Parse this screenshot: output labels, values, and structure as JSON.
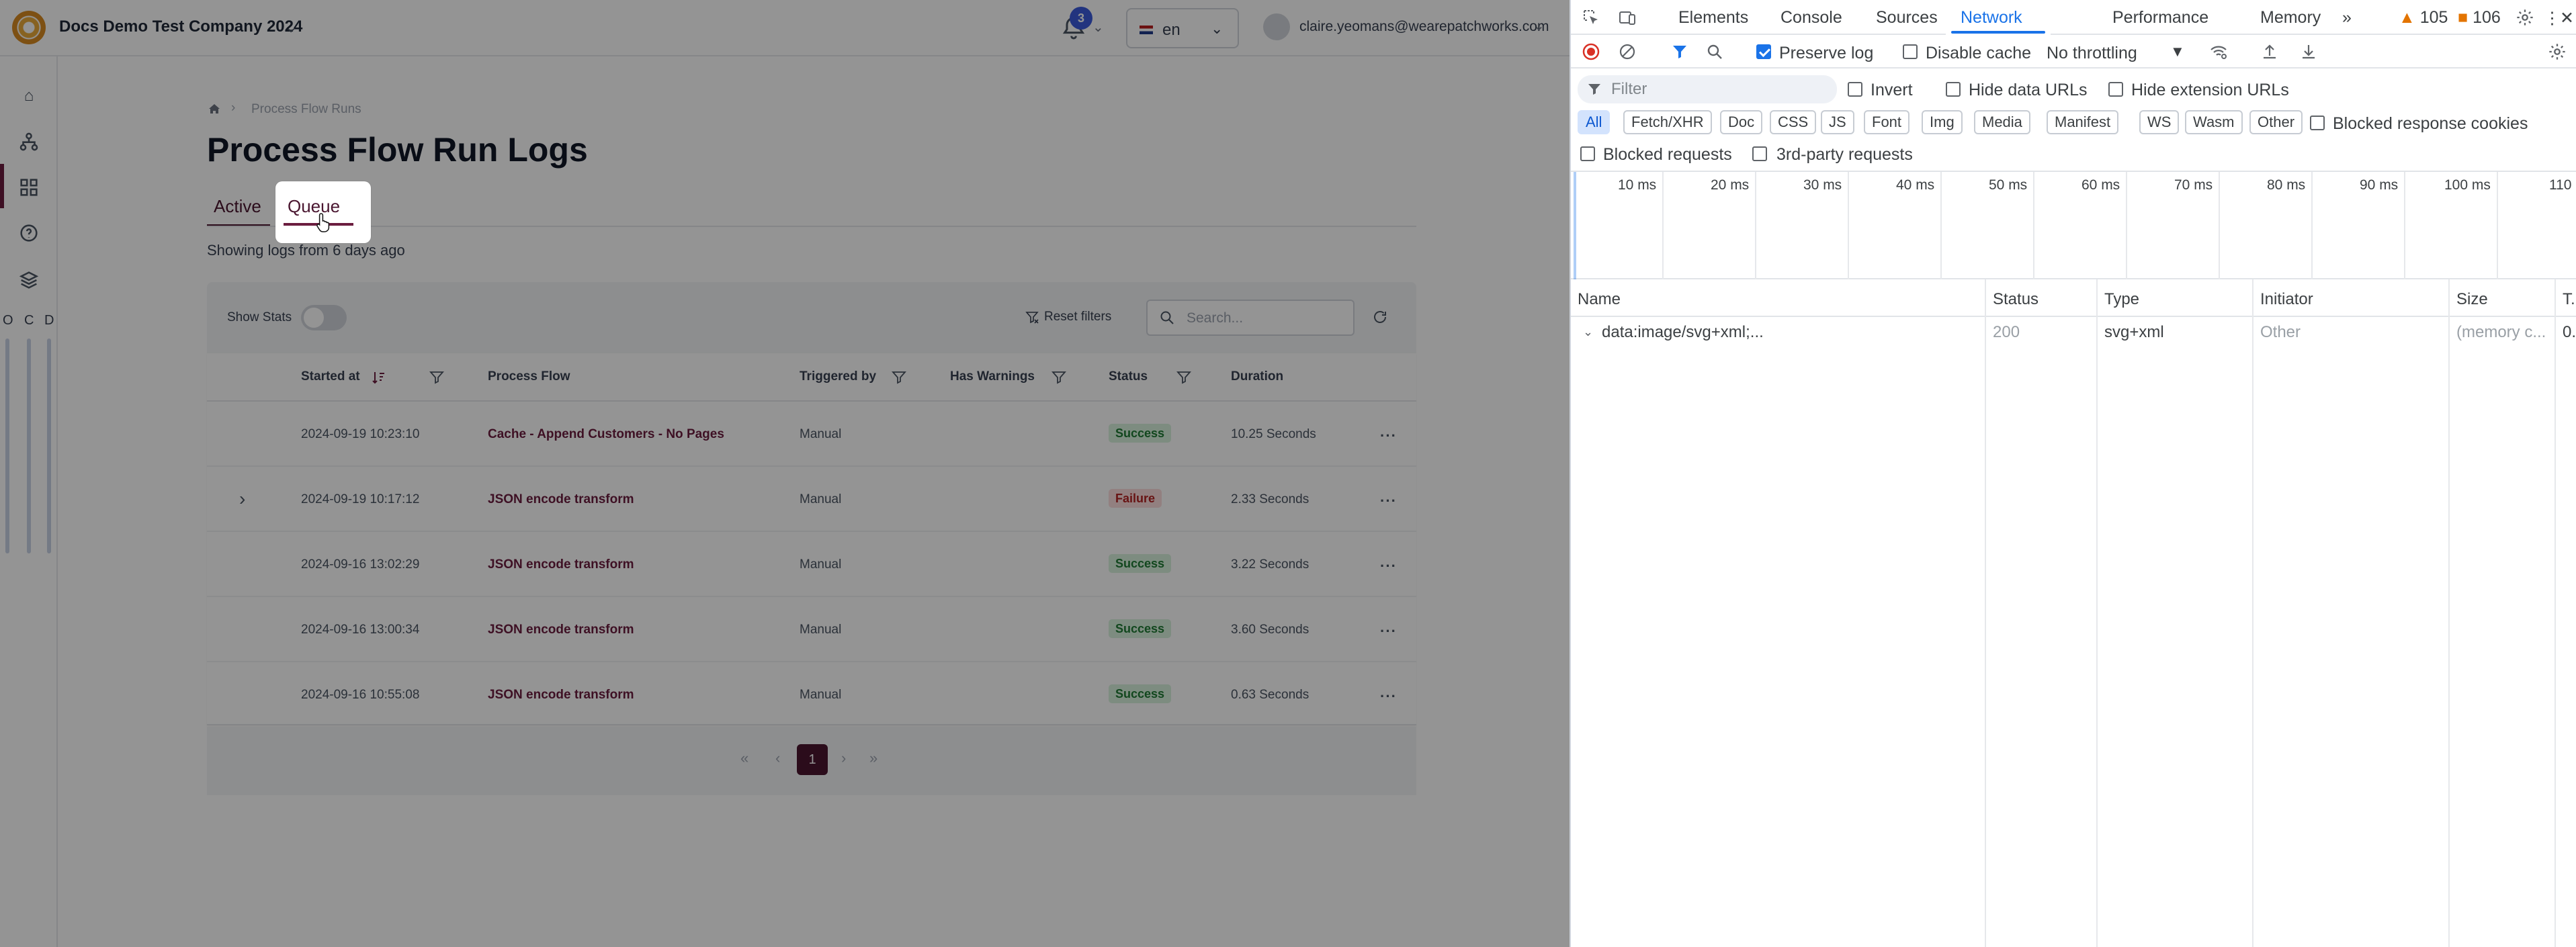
{
  "app": {
    "company_name": "Docs Demo Test Company 2024",
    "notifications_count": "3",
    "language": "en",
    "user_email": "claire.yeomans@wearepatchworks.com",
    "sidebar_letters": [
      "O",
      "C",
      "D"
    ],
    "breadcrumb": "Process Flow Runs",
    "page_title": "Process Flow Run Logs",
    "tabs": [
      {
        "label": "Active",
        "active": false
      },
      {
        "label": "Queue",
        "active": true
      }
    ],
    "showing_text": "Showing logs from 6 days ago",
    "show_stats_label": "Show Stats",
    "reset_filters_label": "Reset filters",
    "search_placeholder": "Search...",
    "table": {
      "columns": [
        "Started at",
        "Process Flow",
        "Triggered by",
        "Has Warnings",
        "Status",
        "Duration"
      ],
      "rows": [
        {
          "started_at": "2024-09-19 10:23:10",
          "process_flow": "Cache - Append Customers - No Pages",
          "triggered_by": "Manual",
          "status": "Success",
          "duration": "10.25 Seconds",
          "expandable": false
        },
        {
          "started_at": "2024-09-19 10:17:12",
          "process_flow": "JSON encode transform",
          "triggered_by": "Manual",
          "status": "Failure",
          "duration": "2.33 Seconds",
          "expandable": true
        },
        {
          "started_at": "2024-09-16 13:02:29",
          "process_flow": "JSON encode transform",
          "triggered_by": "Manual",
          "status": "Success",
          "duration": "3.22 Seconds",
          "expandable": false
        },
        {
          "started_at": "2024-09-16 13:00:34",
          "process_flow": "JSON encode transform",
          "triggered_by": "Manual",
          "status": "Success",
          "duration": "3.60 Seconds",
          "expandable": false
        },
        {
          "started_at": "2024-09-16 10:55:08",
          "process_flow": "JSON encode transform",
          "triggered_by": "Manual",
          "status": "Success",
          "duration": "0.63 Seconds",
          "expandable": false
        }
      ]
    },
    "pagination": {
      "current_page": "1"
    },
    "colors": {
      "brand": "#4a1630",
      "success_bg": "#d7f2dc",
      "failure_bg": "#fbdcdc"
    }
  },
  "devtools": {
    "tabs": [
      "Elements",
      "Console",
      "Sources",
      "Network",
      "Performance",
      "Memory"
    ],
    "active_tab": "Network",
    "warnings_count": "105",
    "issues_count": "106",
    "toolbar": {
      "preserve_log": {
        "label": "Preserve log",
        "checked": true
      },
      "disable_cache": {
        "label": "Disable cache",
        "checked": false
      },
      "throttling": "No throttling"
    },
    "filter": {
      "placeholder": "Filter",
      "invert": "Invert",
      "hide_data_urls": "Hide data URLs",
      "hide_extension_urls": "Hide extension URLs",
      "types": [
        "All",
        "Fetch/XHR",
        "Doc",
        "CSS",
        "JS",
        "Font",
        "Img",
        "Media",
        "Manifest",
        "WS",
        "Wasm",
        "Other"
      ],
      "active_type": "All",
      "blocked_response_cookies": "Blocked response cookies",
      "blocked_requests": "Blocked requests",
      "third_party_requests": "3rd-party requests"
    },
    "timeline_labels": [
      "10 ms",
      "20 ms",
      "30 ms",
      "40 ms",
      "50 ms",
      "60 ms",
      "70 ms",
      "80 ms",
      "90 ms",
      "100 ms",
      "110"
    ],
    "grid": {
      "columns": [
        "Name",
        "Status",
        "Type",
        "Initiator",
        "Size",
        "T..."
      ],
      "rows": [
        {
          "name": "data:image/svg+xml;...",
          "status": "200",
          "type": "svg+xml",
          "initiator": "Other",
          "size": "(memory c...",
          "time": "0."
        }
      ]
    },
    "colors": {
      "accent": "#1a73e8"
    }
  }
}
